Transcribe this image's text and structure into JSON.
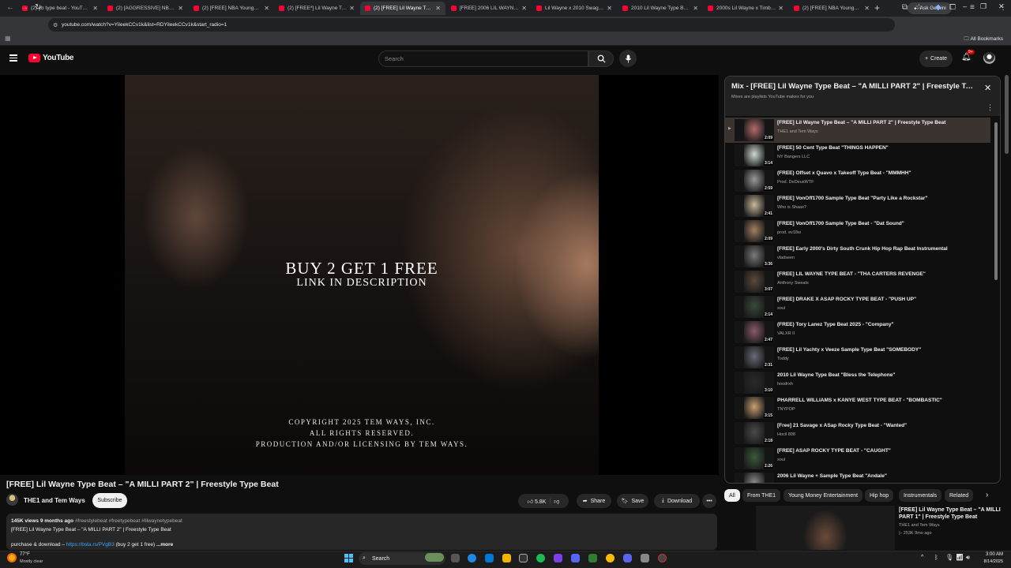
{
  "browser": {
    "tabs": [
      {
        "title": "(2) yb type beat - YouTube",
        "active": false
      },
      {
        "title": "(2) [AGGRESSIVE] NBA Youngboy Type Beat",
        "active": false
      },
      {
        "title": "(2) [FREE] NBA Youngboy Type Beat",
        "active": false
      },
      {
        "title": "(2) [FREE*] Lil Wayne Type Beat",
        "active": false
      },
      {
        "title": "(2) [FREE] Lil Wayne Type Beat",
        "active": true
      },
      {
        "title": "[FREE] 2006 LIL WAYNE TYPE BEAT",
        "active": false
      },
      {
        "title": "Lil Wayne x 2010 Swag Era",
        "active": false
      },
      {
        "title": "2010 Lil Wayne Type Beat",
        "active": false
      },
      {
        "title": "2000s Lil Wayne x Timbaland",
        "active": false
      },
      {
        "title": "(2) [FREE] NBA Youngboy Type Beat",
        "active": false
      }
    ],
    "gemini_label": "Ask Gemini",
    "url": "youtube.com/watch?v=YiIeekCCv1k&list=RDYiIeekCCv1k&start_radio=1",
    "bookmarks_label": "All Bookmarks"
  },
  "youtube": {
    "logo_text": "YouTube",
    "search_placeholder": "Search",
    "create_label": "Create",
    "notification_count": "9+"
  },
  "video": {
    "overlay_line1": "BUY 2 GET 1 FREE",
    "overlay_line2": "LINK IN DESCRIPTION",
    "copyright_line1": "COPYRIGHT 2025 TEM WAYS, INC.",
    "copyright_line2": "ALL RIGHTS RESERVED.",
    "copyright_line3": "PRODUCTION AND/OR LICENSING BY TEM WAYS.",
    "title": "[FREE] Lil Wayne Type Beat – \"A MILLI PART 2\" | Freestyle Type Beat",
    "channel": "THE1 and Tem Ways",
    "subscribe_label": "Subscribe",
    "likes": "5.8K",
    "share_label": "Share",
    "save_label": "Save",
    "download_label": "Download",
    "views_date": "145K views  9 months ago",
    "hashtags": "#freestylebeat #freetypebeat #lilwaynetypebeat",
    "description_line1": "[FREE] Lil Wayne Type Beat – \"A MILLI PART 2\" | Freestyle Type Beat",
    "description_line2_prefix": "purchase & download – ",
    "description_link": "https://bsta.rs/PVgB3",
    "description_line2_suffix": " (buy 2 get 1 free) ",
    "more_label": "...more"
  },
  "playlist": {
    "title": "Mix - [FREE] Lil Wayne Type Beat – \"A MILLI PART 2\" | Freestyle Typ...",
    "subtitle": "Mixes are playlists YouTube makes for you",
    "items": [
      {
        "title": "[FREE] Lil Wayne Type Beat – \"A MILLI PART 2\" | Freestyle Type Beat",
        "channel": "THE1 and Tem Ways",
        "duration": "2:09",
        "active": true,
        "thumb_color": "#b56a6a"
      },
      {
        "title": "[FREE] 50 Cent Type Beat \"THINGS HAPPEN\"",
        "channel": "NY Bangers LLC",
        "duration": "3:14",
        "thumb_color": "#cfd8cf"
      },
      {
        "title": "(FREE) Offset x Quavo x Takeoff Type Beat - \"MMMHH\"",
        "channel": "Prod. DeDeusWTF",
        "duration": "2:59",
        "thumb_color": "#9a9a9a"
      },
      {
        "title": "[FREE] VonOff1700 Sample Type Beat \"Party Like a Rockstar\"",
        "channel": "Who is Shaax?",
        "duration": "2:41",
        "thumb_color": "#c8b79a"
      },
      {
        "title": "[FREE] VonOff1700 Sample Type Beat - \"Dat Sound\"",
        "channel": "prod. ev18w",
        "duration": "2:09",
        "thumb_color": "#a08060"
      },
      {
        "title": "[FREE] Early 2000's Dirty South Crunk Hip Hop Rap Beat Instrumental",
        "channel": "vladseen",
        "duration": "3:36",
        "thumb_color": "#7a7a7a"
      },
      {
        "title": "[FREE] LIL WAYNE TYPE BEAT - \"THA CARTERS REVENGE\"",
        "channel": "Anthony Sweats",
        "duration": "3:07",
        "thumb_color": "#5a4a3a"
      },
      {
        "title": "[FREE] DRAKE X ASAP ROCKY TYPE BEAT - \"PUSH UP\"",
        "channel": "soul",
        "duration": "2:14",
        "thumb_color": "#3a4a3a"
      },
      {
        "title": "(FREE) Tory Lanez Type Beat 2025 - \"Company\"",
        "channel": "VALXR II",
        "duration": "2:47",
        "thumb_color": "#8a5a6a"
      },
      {
        "title": "[FREE] Lil Yachty x Veeze Sample Type Beat \"SOMEBODY\"",
        "channel": "Toddy",
        "duration": "2:31",
        "thumb_color": "#6a6a7a"
      },
      {
        "title": "2010 Lil Wayne Type Beat \"Bless the Telephone\"",
        "channel": "hoodrxh",
        "duration": "3:10",
        "thumb_color": "#2a2a2a"
      },
      {
        "title": "PHARRELL WILLIAMS x KANYE WEST TYPE BEAT - \"BOMBASTIC\"",
        "channel": "TNYPOP",
        "duration": "3:15",
        "thumb_color": "#c8a070"
      },
      {
        "title": "[Free] 21 Savage x ASap Rocky Type Beat - \"Wanted\"",
        "channel": "Hocil 808",
        "duration": "2:18",
        "thumb_color": "#4a4a4a"
      },
      {
        "title": "[FREE] ASAP ROCKY TYPE BEAT - \"CAUGHT\"",
        "channel": "soul",
        "duration": "2:26",
        "thumb_color": "#3a5a3a"
      },
      {
        "title": "2006 Lil Wayne + Sample Type Beat \"Andale\"",
        "channel": "",
        "duration": "",
        "thumb_color": "#8a8a8a"
      }
    ]
  },
  "chips": [
    {
      "label": "All",
      "selected": true
    },
    {
      "label": "From THE1",
      "selected": false
    },
    {
      "label": "Young Money Entertainment",
      "selected": false
    },
    {
      "label": "Hip hop",
      "selected": false
    },
    {
      "label": "Instrumentals",
      "selected": false
    },
    {
      "label": "Related",
      "selected": false
    }
  ],
  "related": {
    "title": "[FREE] Lil Wayne Type Beat – \"A MILLI PART 1\" | Freestyle Type Beat",
    "channel": "THE1 and Tem Ways",
    "meta": "▷ 253K  9mo ago"
  },
  "taskbar": {
    "weather_temp": "77°F",
    "weather_desc": "Mostly clear",
    "search_label": "Search",
    "time": "3:00 AM",
    "date": "8/14/2025"
  },
  "colors": {
    "yt_red": "#ff0033",
    "link_blue": "#3ea6ff",
    "background": "#0f0f0f"
  }
}
